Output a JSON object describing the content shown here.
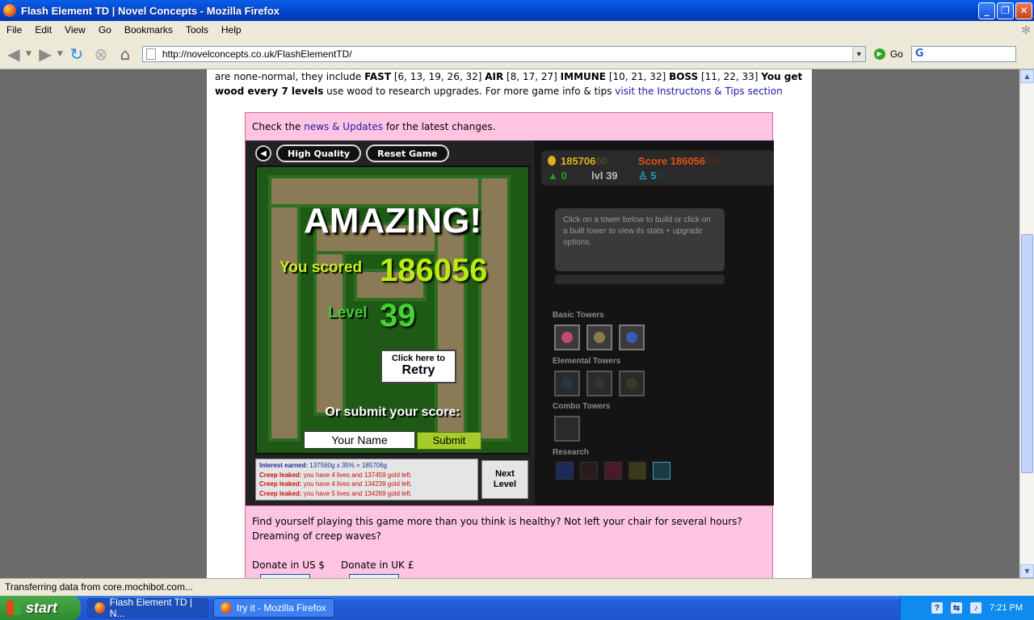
{
  "window": {
    "title": "Flash Element TD | Novel Concepts - Mozilla Firefox"
  },
  "menu": [
    "File",
    "Edit",
    "View",
    "Go",
    "Bookmarks",
    "Tools",
    "Help"
  ],
  "nav": {
    "url": "http://novelconcepts.co.uk/FlashElementTD/",
    "go_label": "Go",
    "search_logo": "G"
  },
  "page": {
    "intro_line1_a": "are none-normal, they include ",
    "fast": "FAST",
    "fast_levels": " [6, 13, 19, 26, 32] ",
    "air": "AIR",
    "air_levels": " [8, 17, 27] ",
    "immune": "IMMUNE",
    "immune_levels": " [10, 21, 32] ",
    "boss": "BOSS",
    "boss_levels": " [11, 22, 33] ",
    "wood_bold": "You get wood every 7 levels",
    "intro_line2_rest": " use wood to research upgrades. For more game info & tips ",
    "tips_link": "visit the Instructons & Tips section",
    "check_a": "Check the ",
    "news_link": "news & Updates",
    "check_b": " for the latest changes.",
    "healthy_text": "Find yourself playing this game more than you think is healthy? Not left your chair for several hours? Dreaming of creep waves?",
    "donate_us": "Donate in US $",
    "donate_uk": "Donate in UK £"
  },
  "game": {
    "buttons": {
      "quality": "High Quality",
      "reset": "Reset Game"
    },
    "result": {
      "headline": "AMAZING!",
      "scored_label": "You scored",
      "score": "186056",
      "level_label": "Level",
      "level": "39",
      "retry_small": "Click here to",
      "retry_big": "Retry",
      "submit_prompt": "Or submit your score:",
      "name_placeholder": "Your Name",
      "submit_label": "Submit"
    },
    "log": [
      {
        "label": "Interest earned:",
        "text": " 137560g x 35% = 185706g",
        "type": "interest"
      },
      {
        "label": "Creep leaked:",
        "text": " you have 4 lives and 137459 gold left.",
        "type": "leak"
      },
      {
        "label": "Creep leaked:",
        "text": " you have 4 lives and 134239 gold left.",
        "type": "leak"
      },
      {
        "label": "Creep leaked:",
        "text": " you have 5 lives and 134269 gold left.",
        "type": "leak"
      }
    ],
    "next_level": {
      "line1": "Next",
      "line2": "Level"
    },
    "stats": {
      "gold": "185706",
      "gold_pad": "00",
      "score_label": "Score",
      "score": "186056",
      "score_pad": "000",
      "wood": "0",
      "level": "lvl 39",
      "lives": "5",
      "lives_pad": "00"
    },
    "info": "Click on a tower below to build or click on a built tower to view its stats + upgrade options.",
    "sections": {
      "basic": "Basic Towers",
      "elemental": "Elemental Towers",
      "combo": "Combo Towers",
      "research": "Research"
    },
    "colors": {
      "gold": "#e0b020",
      "score": "#e05018",
      "wood": "#1ea01e",
      "lives": "#20a0c0"
    }
  },
  "status": "Transferring data from core.mochibot.com...",
  "taskbar": {
    "start": "start",
    "items": [
      "Flash Element TD | N...",
      "try it - Mozilla Firefox"
    ],
    "clock": "7:21 PM"
  }
}
